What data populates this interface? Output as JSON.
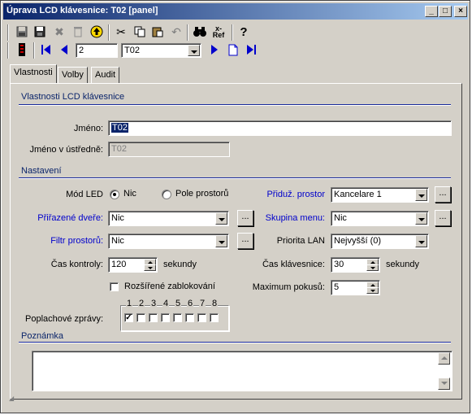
{
  "window": {
    "title": "Úprava LCD klávesnice: T02 [panel]",
    "minimize": "_",
    "maximize": "□",
    "close": "×"
  },
  "toolbar": {
    "record_number": "2",
    "record_select": "T02",
    "ref_label": "Ref",
    "ref_x": "x-"
  },
  "tabs": [
    {
      "label": "Vlastnosti",
      "active": true
    },
    {
      "label": "Volby",
      "active": false
    },
    {
      "label": "Audit",
      "active": false
    }
  ],
  "section_properties": {
    "title": "Vlastnosti LCD klávesnice",
    "name_label": "Jméno:",
    "name_value": "T02",
    "central_name_label": "Jméno v ústředně:",
    "central_name_value": "T02"
  },
  "section_settings": {
    "title": "Nastavení",
    "led_mode_label": "Mód LED",
    "led_option_none": "Nic",
    "led_option_areas": "Pole prostorů",
    "assigned_area_label": "Přiduž. prostor",
    "assigned_area_value": "Kancelare 1",
    "assigned_doors_label": "Přiřazené dveře:",
    "assigned_doors_value": "Nic",
    "menu_group_label": "Skupina menu:",
    "menu_group_value": "Nic",
    "area_filter_label": "Filtr prostorů:",
    "area_filter_value": "Nic",
    "lan_priority_label": "Priorita LAN",
    "lan_priority_value": "Nejvyšší (0)",
    "check_time_label": "Čas kontroly:",
    "check_time_value": "120",
    "check_time_unit": "sekundy",
    "keypad_time_label": "Čas klávesnice:",
    "keypad_time_value": "30",
    "keypad_time_unit": "sekundy",
    "extended_lock_label": "Rozšířené zablokování",
    "max_attempts_label": "Maximum pokusů:",
    "max_attempts_value": "5",
    "alarm_messages_label": "Poplachové zprávy:",
    "alarm_numbers": [
      "1",
      "2",
      "3",
      "4",
      "5",
      "6",
      "7",
      "8"
    ],
    "alarm_checked": [
      true,
      false,
      false,
      false,
      false,
      false,
      false,
      false
    ]
  },
  "section_note": {
    "title": "Poznámka",
    "value": ""
  },
  "colors": {
    "title_bar": "#0a246a",
    "link_label": "#0000cc",
    "face": "#d4d0c8"
  }
}
